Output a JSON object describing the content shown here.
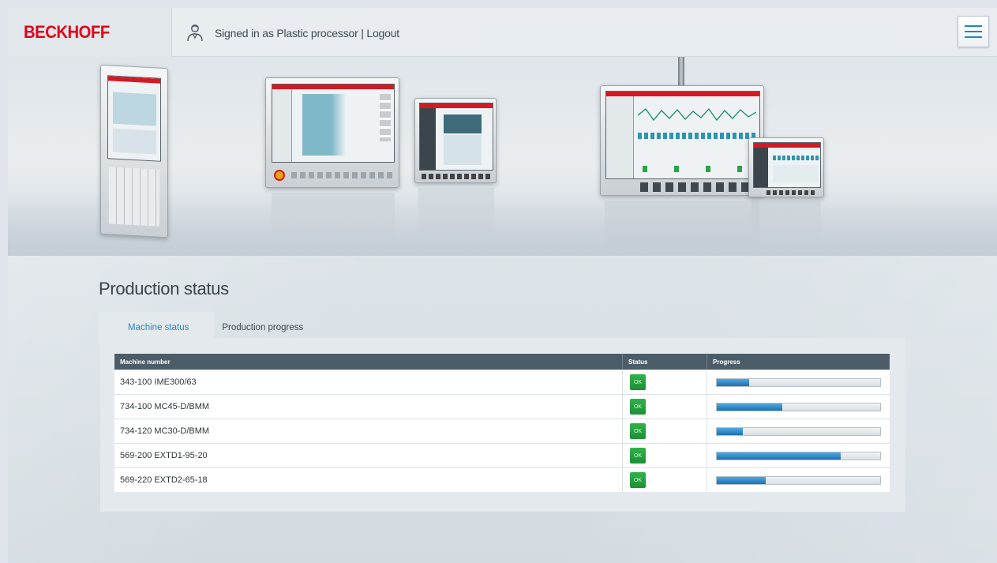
{
  "header": {
    "logo": "BECKHOFF",
    "signed_in_text": "Signed in as Plastic processor | Logout",
    "menu_icon": "hamburger-menu-icon",
    "brand_color": "#e2001a",
    "accent_color": "#1f86c7"
  },
  "main": {
    "title": "Production status",
    "tabs": [
      {
        "label": "Machine status",
        "active": true
      },
      {
        "label": "Production progress",
        "active": false
      }
    ],
    "table": {
      "headers": [
        "Machine number",
        "Status",
        "Progress"
      ],
      "rows": [
        {
          "machine": "343-100 IME300/63",
          "status": "OK",
          "progress": 0.2
        },
        {
          "machine": "734-100 MC45-D/BMM",
          "status": "OK",
          "progress": 0.4
        },
        {
          "machine": "734-120 MC30-D/BMM",
          "status": "OK",
          "progress": 0.16
        },
        {
          "machine": "569-200 EXTD1-95-20",
          "status": "OK",
          "progress": 0.76
        },
        {
          "machine": "569-220 EXTD2-65-18",
          "status": "OK",
          "progress": 0.3
        }
      ]
    },
    "status_ok_color": "#2fb34a",
    "header_bg_color": "#4c5d69"
  }
}
